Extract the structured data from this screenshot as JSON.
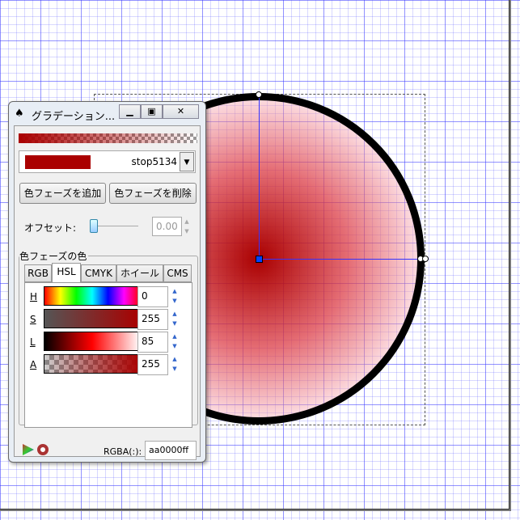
{
  "dialog": {
    "title": "グラデーション...",
    "stop": {
      "name": "stop5134",
      "color": "#aa0000"
    },
    "buttons": {
      "add": "色フェーズを追加",
      "delete": "色フェーズを削除"
    },
    "offset": {
      "label": "オフセット:",
      "value": "0.00",
      "fraction": 0
    },
    "color_section": {
      "label": "色フェーズの色",
      "tabs": [
        "RGB",
        "HSL",
        "CMYK",
        "ホイール",
        "CMS"
      ],
      "active_tab": "HSL",
      "channels": [
        {
          "label": "H",
          "value": "0"
        },
        {
          "label": "S",
          "value": "255"
        },
        {
          "label": "L",
          "value": "85"
        },
        {
          "label": "A",
          "value": "255"
        }
      ],
      "rgba_label": "RGBA(:):",
      "rgba_value": "aa0000ff"
    }
  },
  "canvas": {
    "gradient_color": "#aa0000",
    "grid_color": "#3333ff"
  }
}
